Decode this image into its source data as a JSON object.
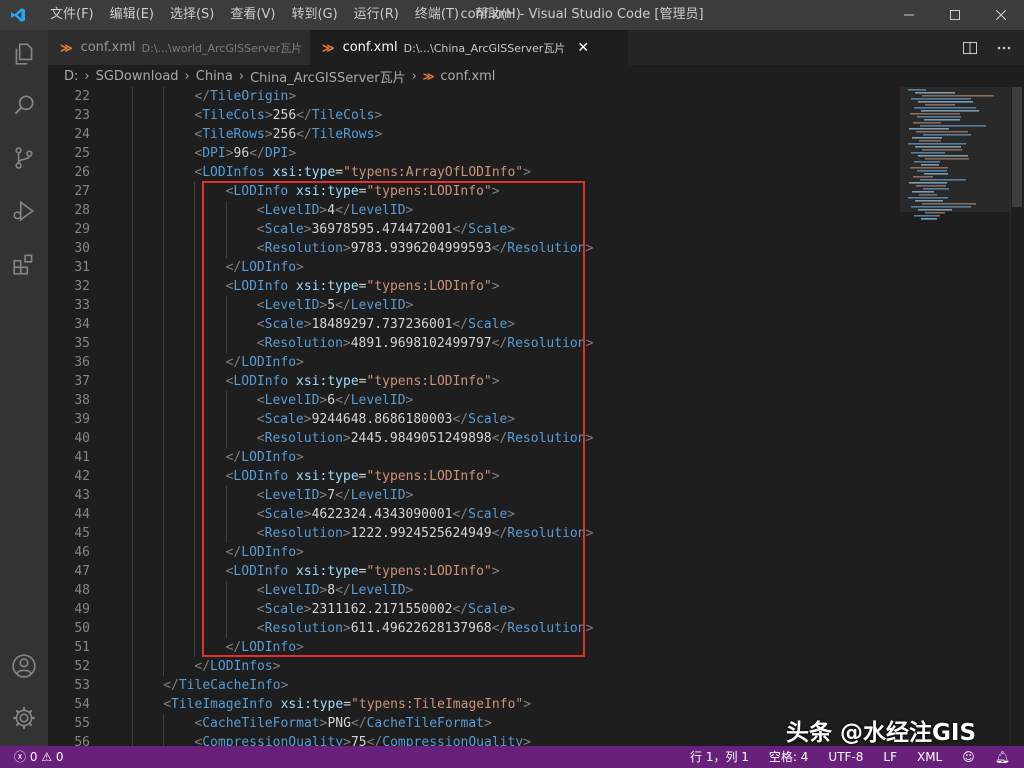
{
  "window": {
    "title": "conf.xml - Visual Studio Code [管理员]",
    "menu": [
      "文件(F)",
      "编辑(E)",
      "选择(S)",
      "查看(V)",
      "转到(G)",
      "运行(R)",
      "终端(T)",
      "帮助(H)"
    ]
  },
  "tabs": [
    {
      "name": "conf.xml",
      "path": "D:\\...\\world_ArcGISServer瓦片",
      "active": false
    },
    {
      "name": "conf.xml",
      "path": "D:\\...\\China_ArcGISServer瓦片",
      "active": true,
      "close": "✕"
    }
  ],
  "breadcrumbs": [
    "D:",
    "SGDownload",
    "China",
    "China_ArcGISServer瓦片",
    "conf.xml"
  ],
  "breadcrumb_sep": "›",
  "file_icon": "≫",
  "activity_icons": [
    "explorer-icon",
    "search-icon",
    "source-control-icon",
    "run-debug-icon",
    "extensions-icon",
    "account-icon",
    "settings-gear-icon"
  ],
  "code": {
    "first_line": 22,
    "lines": [
      {
        "n": "22",
        "i": 2,
        "t": [
          [
            "b",
            "</"
          ],
          [
            "tag",
            "TileOrigin"
          ],
          [
            "b",
            ">"
          ]
        ]
      },
      {
        "n": "23",
        "i": 2,
        "t": [
          [
            "b",
            "<"
          ],
          [
            "tag",
            "TileCols"
          ],
          [
            "b",
            ">"
          ],
          [
            "txt",
            "256"
          ],
          [
            "b",
            "</"
          ],
          [
            "tag",
            "TileCols"
          ],
          [
            "b",
            ">"
          ]
        ]
      },
      {
        "n": "24",
        "i": 2,
        "t": [
          [
            "b",
            "<"
          ],
          [
            "tag",
            "TileRows"
          ],
          [
            "b",
            ">"
          ],
          [
            "txt",
            "256"
          ],
          [
            "b",
            "</"
          ],
          [
            "tag",
            "TileRows"
          ],
          [
            "b",
            ">"
          ]
        ]
      },
      {
        "n": "25",
        "i": 2,
        "t": [
          [
            "b",
            "<"
          ],
          [
            "tag",
            "DPI"
          ],
          [
            "b",
            ">"
          ],
          [
            "txt",
            "96"
          ],
          [
            "b",
            "</"
          ],
          [
            "tag",
            "DPI"
          ],
          [
            "b",
            ">"
          ]
        ]
      },
      {
        "n": "26",
        "i": 2,
        "t": [
          [
            "b",
            "<"
          ],
          [
            "tag",
            "LODInfos"
          ],
          [
            "txt",
            " "
          ],
          [
            "attr",
            "xsi:type"
          ],
          [
            "txt",
            "="
          ],
          [
            "str",
            "\"typens:ArrayOfLODInfo\""
          ],
          [
            "b",
            ">"
          ]
        ]
      },
      {
        "n": "27",
        "i": 3,
        "t": [
          [
            "b",
            "<"
          ],
          [
            "tag",
            "LODInfo"
          ],
          [
            "txt",
            " "
          ],
          [
            "attr",
            "xsi:type"
          ],
          [
            "txt",
            "="
          ],
          [
            "str",
            "\"typens:LODInfo\""
          ],
          [
            "b",
            ">"
          ]
        ]
      },
      {
        "n": "28",
        "i": 4,
        "t": [
          [
            "b",
            "<"
          ],
          [
            "tag",
            "LevelID"
          ],
          [
            "b",
            ">"
          ],
          [
            "txt",
            "4"
          ],
          [
            "b",
            "</"
          ],
          [
            "tag",
            "LevelID"
          ],
          [
            "b",
            ">"
          ]
        ]
      },
      {
        "n": "29",
        "i": 4,
        "t": [
          [
            "b",
            "<"
          ],
          [
            "tag",
            "Scale"
          ],
          [
            "b",
            ">"
          ],
          [
            "txt",
            "36978595.474472001"
          ],
          [
            "b",
            "</"
          ],
          [
            "tag",
            "Scale"
          ],
          [
            "b",
            ">"
          ]
        ]
      },
      {
        "n": "30",
        "i": 4,
        "t": [
          [
            "b",
            "<"
          ],
          [
            "tag",
            "Resolution"
          ],
          [
            "b",
            ">"
          ],
          [
            "txt",
            "9783.9396204999593"
          ],
          [
            "b",
            "</"
          ],
          [
            "tag",
            "Resolution"
          ],
          [
            "b",
            ">"
          ]
        ]
      },
      {
        "n": "31",
        "i": 3,
        "t": [
          [
            "b",
            "</"
          ],
          [
            "tag",
            "LODInfo"
          ],
          [
            "b",
            ">"
          ]
        ]
      },
      {
        "n": "32",
        "i": 3,
        "t": [
          [
            "b",
            "<"
          ],
          [
            "tag",
            "LODInfo"
          ],
          [
            "txt",
            " "
          ],
          [
            "attr",
            "xsi:type"
          ],
          [
            "txt",
            "="
          ],
          [
            "str",
            "\"typens:LODInfo\""
          ],
          [
            "b",
            ">"
          ]
        ]
      },
      {
        "n": "33",
        "i": 4,
        "t": [
          [
            "b",
            "<"
          ],
          [
            "tag",
            "LevelID"
          ],
          [
            "b",
            ">"
          ],
          [
            "txt",
            "5"
          ],
          [
            "b",
            "</"
          ],
          [
            "tag",
            "LevelID"
          ],
          [
            "b",
            ">"
          ]
        ]
      },
      {
        "n": "34",
        "i": 4,
        "t": [
          [
            "b",
            "<"
          ],
          [
            "tag",
            "Scale"
          ],
          [
            "b",
            ">"
          ],
          [
            "txt",
            "18489297.737236001"
          ],
          [
            "b",
            "</"
          ],
          [
            "tag",
            "Scale"
          ],
          [
            "b",
            ">"
          ]
        ]
      },
      {
        "n": "35",
        "i": 4,
        "t": [
          [
            "b",
            "<"
          ],
          [
            "tag",
            "Resolution"
          ],
          [
            "b",
            ">"
          ],
          [
            "txt",
            "4891.9698102499797"
          ],
          [
            "b",
            "</"
          ],
          [
            "tag",
            "Resolution"
          ],
          [
            "b",
            ">"
          ]
        ]
      },
      {
        "n": "36",
        "i": 3,
        "t": [
          [
            "b",
            "</"
          ],
          [
            "tag",
            "LODInfo"
          ],
          [
            "b",
            ">"
          ]
        ]
      },
      {
        "n": "37",
        "i": 3,
        "t": [
          [
            "b",
            "<"
          ],
          [
            "tag",
            "LODInfo"
          ],
          [
            "txt",
            " "
          ],
          [
            "attr",
            "xsi:type"
          ],
          [
            "txt",
            "="
          ],
          [
            "str",
            "\"typens:LODInfo\""
          ],
          [
            "b",
            ">"
          ]
        ]
      },
      {
        "n": "38",
        "i": 4,
        "t": [
          [
            "b",
            "<"
          ],
          [
            "tag",
            "LevelID"
          ],
          [
            "b",
            ">"
          ],
          [
            "txt",
            "6"
          ],
          [
            "b",
            "</"
          ],
          [
            "tag",
            "LevelID"
          ],
          [
            "b",
            ">"
          ]
        ]
      },
      {
        "n": "39",
        "i": 4,
        "t": [
          [
            "b",
            "<"
          ],
          [
            "tag",
            "Scale"
          ],
          [
            "b",
            ">"
          ],
          [
            "txt",
            "9244648.8686180003"
          ],
          [
            "b",
            "</"
          ],
          [
            "tag",
            "Scale"
          ],
          [
            "b",
            ">"
          ]
        ]
      },
      {
        "n": "40",
        "i": 4,
        "t": [
          [
            "b",
            "<"
          ],
          [
            "tag",
            "Resolution"
          ],
          [
            "b",
            ">"
          ],
          [
            "txt",
            "2445.9849051249898"
          ],
          [
            "b",
            "</"
          ],
          [
            "tag",
            "Resolution"
          ],
          [
            "b",
            ">"
          ]
        ]
      },
      {
        "n": "41",
        "i": 3,
        "t": [
          [
            "b",
            "</"
          ],
          [
            "tag",
            "LODInfo"
          ],
          [
            "b",
            ">"
          ]
        ]
      },
      {
        "n": "42",
        "i": 3,
        "t": [
          [
            "b",
            "<"
          ],
          [
            "tag",
            "LODInfo"
          ],
          [
            "txt",
            " "
          ],
          [
            "attr",
            "xsi:type"
          ],
          [
            "txt",
            "="
          ],
          [
            "str",
            "\"typens:LODInfo\""
          ],
          [
            "b",
            ">"
          ]
        ]
      },
      {
        "n": "43",
        "i": 4,
        "t": [
          [
            "b",
            "<"
          ],
          [
            "tag",
            "LevelID"
          ],
          [
            "b",
            ">"
          ],
          [
            "txt",
            "7"
          ],
          [
            "b",
            "</"
          ],
          [
            "tag",
            "LevelID"
          ],
          [
            "b",
            ">"
          ]
        ]
      },
      {
        "n": "44",
        "i": 4,
        "t": [
          [
            "b",
            "<"
          ],
          [
            "tag",
            "Scale"
          ],
          [
            "b",
            ">"
          ],
          [
            "txt",
            "4622324.4343090001"
          ],
          [
            "b",
            "</"
          ],
          [
            "tag",
            "Scale"
          ],
          [
            "b",
            ">"
          ]
        ]
      },
      {
        "n": "45",
        "i": 4,
        "t": [
          [
            "b",
            "<"
          ],
          [
            "tag",
            "Resolution"
          ],
          [
            "b",
            ">"
          ],
          [
            "txt",
            "1222.9924525624949"
          ],
          [
            "b",
            "</"
          ],
          [
            "tag",
            "Resolution"
          ],
          [
            "b",
            ">"
          ]
        ]
      },
      {
        "n": "46",
        "i": 3,
        "t": [
          [
            "b",
            "</"
          ],
          [
            "tag",
            "LODInfo"
          ],
          [
            "b",
            ">"
          ]
        ]
      },
      {
        "n": "47",
        "i": 3,
        "t": [
          [
            "b",
            "<"
          ],
          [
            "tag",
            "LODInfo"
          ],
          [
            "txt",
            " "
          ],
          [
            "attr",
            "xsi:type"
          ],
          [
            "txt",
            "="
          ],
          [
            "str",
            "\"typens:LODInfo\""
          ],
          [
            "b",
            ">"
          ]
        ]
      },
      {
        "n": "48",
        "i": 4,
        "t": [
          [
            "b",
            "<"
          ],
          [
            "tag",
            "LevelID"
          ],
          [
            "b",
            ">"
          ],
          [
            "txt",
            "8"
          ],
          [
            "b",
            "</"
          ],
          [
            "tag",
            "LevelID"
          ],
          [
            "b",
            ">"
          ]
        ]
      },
      {
        "n": "49",
        "i": 4,
        "t": [
          [
            "b",
            "<"
          ],
          [
            "tag",
            "Scale"
          ],
          [
            "b",
            ">"
          ],
          [
            "txt",
            "2311162.2171550002"
          ],
          [
            "b",
            "</"
          ],
          [
            "tag",
            "Scale"
          ],
          [
            "b",
            ">"
          ]
        ]
      },
      {
        "n": "50",
        "i": 4,
        "t": [
          [
            "b",
            "<"
          ],
          [
            "tag",
            "Resolution"
          ],
          [
            "b",
            ">"
          ],
          [
            "txt",
            "611.49622628137968"
          ],
          [
            "b",
            "</"
          ],
          [
            "tag",
            "Resolution"
          ],
          [
            "b",
            ">"
          ]
        ]
      },
      {
        "n": "51",
        "i": 3,
        "t": [
          [
            "b",
            "</"
          ],
          [
            "tag",
            "LODInfo"
          ],
          [
            "b",
            ">"
          ]
        ]
      },
      {
        "n": "52",
        "i": 2,
        "t": [
          [
            "b",
            "</"
          ],
          [
            "tag",
            "LODInfos"
          ],
          [
            "b",
            ">"
          ]
        ]
      },
      {
        "n": "53",
        "i": 1,
        "t": [
          [
            "b",
            "</"
          ],
          [
            "tag",
            "TileCacheInfo"
          ],
          [
            "b",
            ">"
          ]
        ]
      },
      {
        "n": "54",
        "i": 1,
        "t": [
          [
            "b",
            "<"
          ],
          [
            "tag",
            "TileImageInfo"
          ],
          [
            "txt",
            " "
          ],
          [
            "attr",
            "xsi:type"
          ],
          [
            "txt",
            "="
          ],
          [
            "str",
            "\"typens:TileImageInfo\""
          ],
          [
            "b",
            ">"
          ]
        ]
      },
      {
        "n": "55",
        "i": 2,
        "t": [
          [
            "b",
            "<"
          ],
          [
            "tag",
            "CacheTileFormat"
          ],
          [
            "b",
            ">"
          ],
          [
            "txt",
            "PNG"
          ],
          [
            "b",
            "</"
          ],
          [
            "tag",
            "CacheTileFormat"
          ],
          [
            "b",
            ">"
          ]
        ]
      },
      {
        "n": "56",
        "i": 2,
        "t": [
          [
            "b",
            "<"
          ],
          [
            "tag",
            "CompressionQuality"
          ],
          [
            "b",
            ">"
          ],
          [
            "txt",
            "75"
          ],
          [
            "b",
            "</"
          ],
          [
            "tag",
            "CompressionQuality"
          ],
          [
            "b",
            ">"
          ]
        ]
      }
    ]
  },
  "status": {
    "errors": "0",
    "warnings": "0",
    "position": "行 1，列 1",
    "spaces": "空格: 4",
    "encoding": "UTF-8",
    "eol": "LF",
    "language": "XML"
  },
  "watermark": "头条 @水经注GIS",
  "colors": {
    "tag": "#569cd6",
    "attr": "#9cdcfe",
    "string": "#ce9178",
    "bracket": "#808080",
    "text": "#d4d4d4",
    "statusbar": "#68217a",
    "highlight_box": "#e0322d"
  }
}
